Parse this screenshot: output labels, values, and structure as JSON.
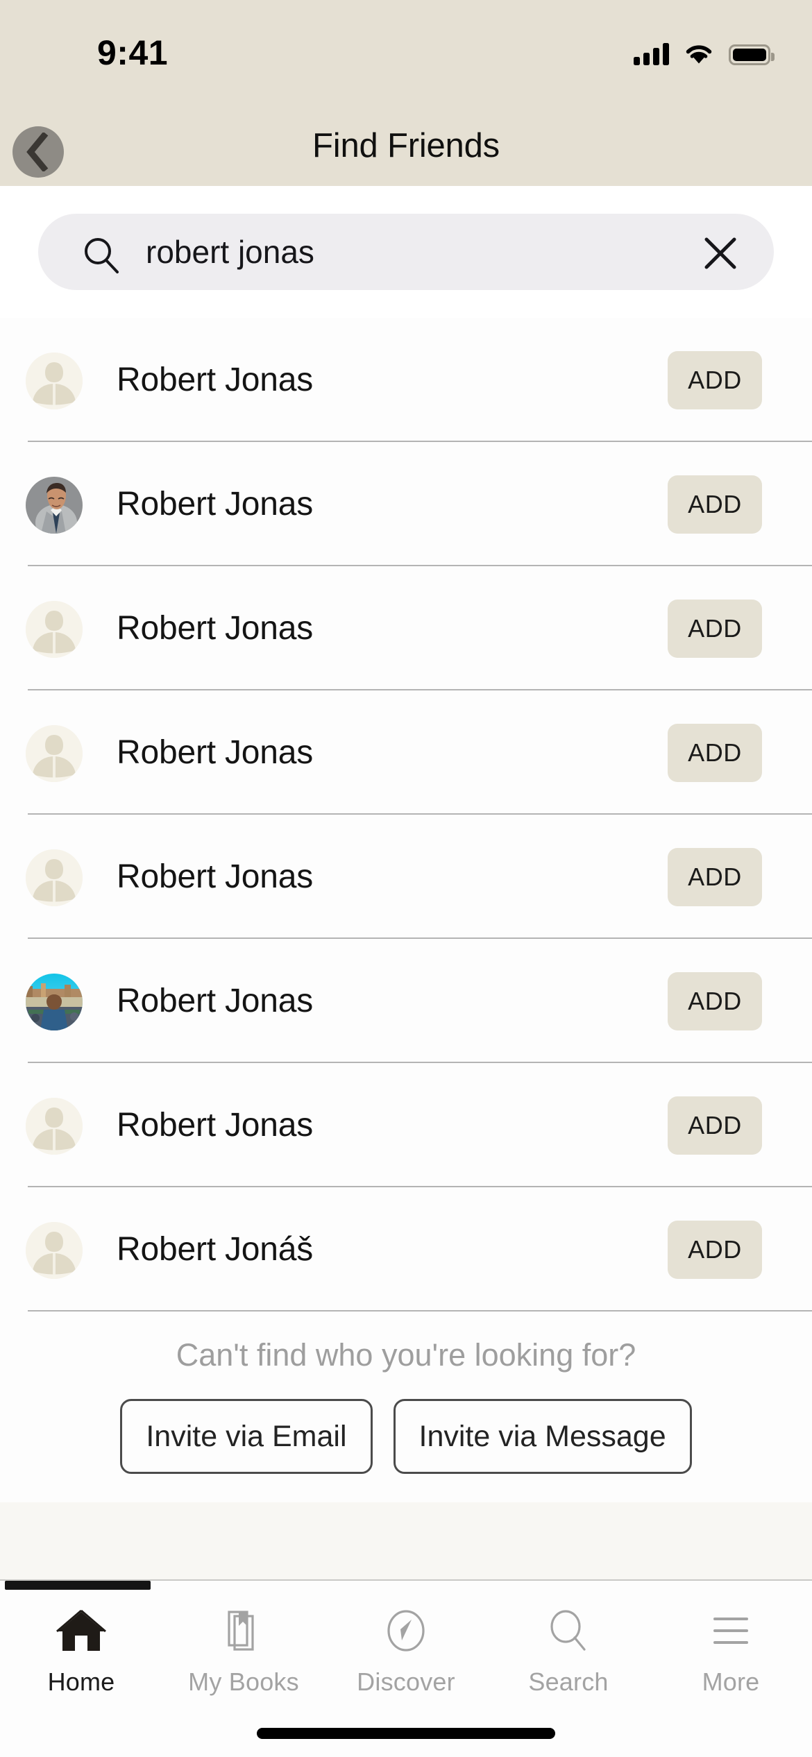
{
  "status_bar": {
    "time": "9:41",
    "signal_icon": "cellular-signal-icon",
    "wifi_icon": "wifi-icon",
    "battery_icon": "battery-full-icon"
  },
  "header": {
    "title": "Find Friends",
    "back_icon": "chevron-left-icon",
    "background_color": "#e5e0d3"
  },
  "search": {
    "value": "robert jonas",
    "placeholder": "Search",
    "search_icon": "search-icon",
    "clear_icon": "close-icon",
    "field_color": "#eeedf0"
  },
  "results": {
    "add_label": "ADD",
    "rows": [
      {
        "name": "Robert Jonas",
        "avatar_type": "placeholder",
        "add_label": "ADD"
      },
      {
        "name": "Robert Jonas",
        "avatar_type": "photo-man-suit",
        "add_label": "ADD"
      },
      {
        "name": "Robert Jonas",
        "avatar_type": "placeholder",
        "add_label": "ADD"
      },
      {
        "name": "Robert Jonas",
        "avatar_type": "placeholder",
        "add_label": "ADD"
      },
      {
        "name": "Robert Jonas",
        "avatar_type": "placeholder",
        "add_label": "ADD"
      },
      {
        "name": "Robert Jonas",
        "avatar_type": "photo-outdoor-crowd",
        "add_label": "ADD"
      },
      {
        "name": "Robert Jonas",
        "avatar_type": "placeholder",
        "add_label": "ADD"
      },
      {
        "name": "Robert Jonáš",
        "avatar_type": "placeholder",
        "add_label": "ADD"
      }
    ]
  },
  "invite": {
    "prompt": "Can't find who you're looking for?",
    "email_label": "Invite via Email",
    "message_label": "Invite via Message"
  },
  "tab_bar": {
    "tabs": [
      {
        "label": "Home",
        "icon": "home-icon",
        "active": true
      },
      {
        "label": "My Books",
        "icon": "books-bookmark-icon",
        "active": false
      },
      {
        "label": "Discover",
        "icon": "compass-icon",
        "active": false
      },
      {
        "label": "Search",
        "icon": "search-icon",
        "active": false
      },
      {
        "label": "More",
        "icon": "hamburger-menu-icon",
        "active": false
      }
    ],
    "active_color": "#1a1a1a",
    "inactive_color": "#a3a3a3"
  },
  "colors": {
    "header_beige": "#e5e0d3",
    "add_button_beige": "#e5e1d4",
    "avatar_placeholder": "#f4f1e8",
    "separator": "#b4b4b4",
    "page_background": "#fdfdfd"
  }
}
